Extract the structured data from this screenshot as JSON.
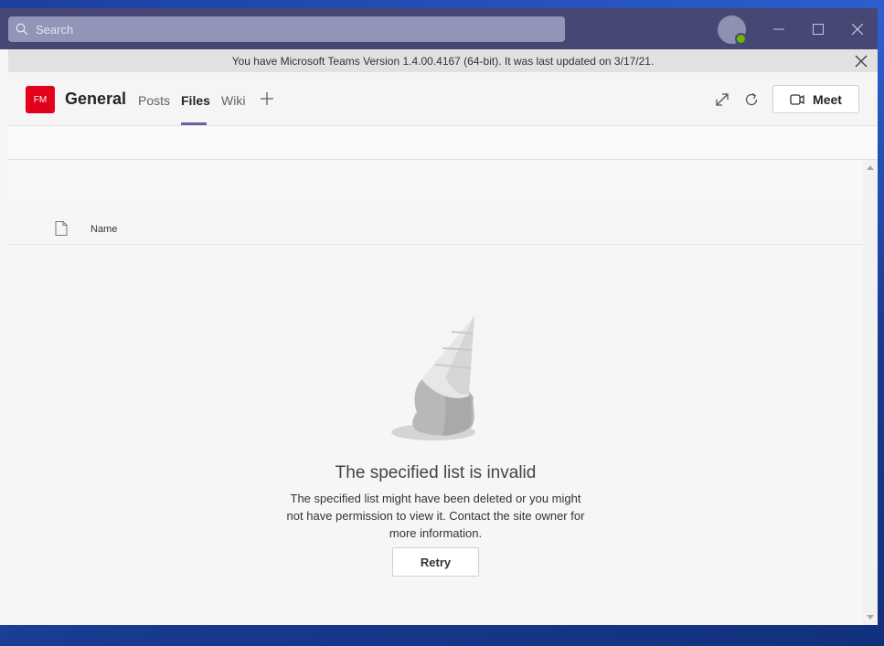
{
  "titlebar": {
    "search_placeholder": "Search",
    "icons": [
      "search-icon",
      "minimize-icon",
      "maximize-icon",
      "close-icon"
    ]
  },
  "banner": {
    "text": "You have Microsoft Teams Version 1.4.00.4167 (64-bit). It was last updated on 3/17/21."
  },
  "channel": {
    "team_initials": "FM",
    "title": "General",
    "tabs": [
      {
        "label": "Posts",
        "active": false
      },
      {
        "label": "Files",
        "active": true
      },
      {
        "label": "Wiki",
        "active": false
      }
    ],
    "meet_label": "Meet"
  },
  "files": {
    "column_name": "Name"
  },
  "error": {
    "title": "The specified list is invalid",
    "line1": "The specified list might have been deleted or you might",
    "line2": "not have permission to view it. Contact the site owner for",
    "line3": "more information.",
    "retry_label": "Retry"
  },
  "colors": {
    "titlebar": "#464775",
    "accent": "#6264a7",
    "team_avatar": "#e2001a",
    "presence": "#6bb700"
  }
}
